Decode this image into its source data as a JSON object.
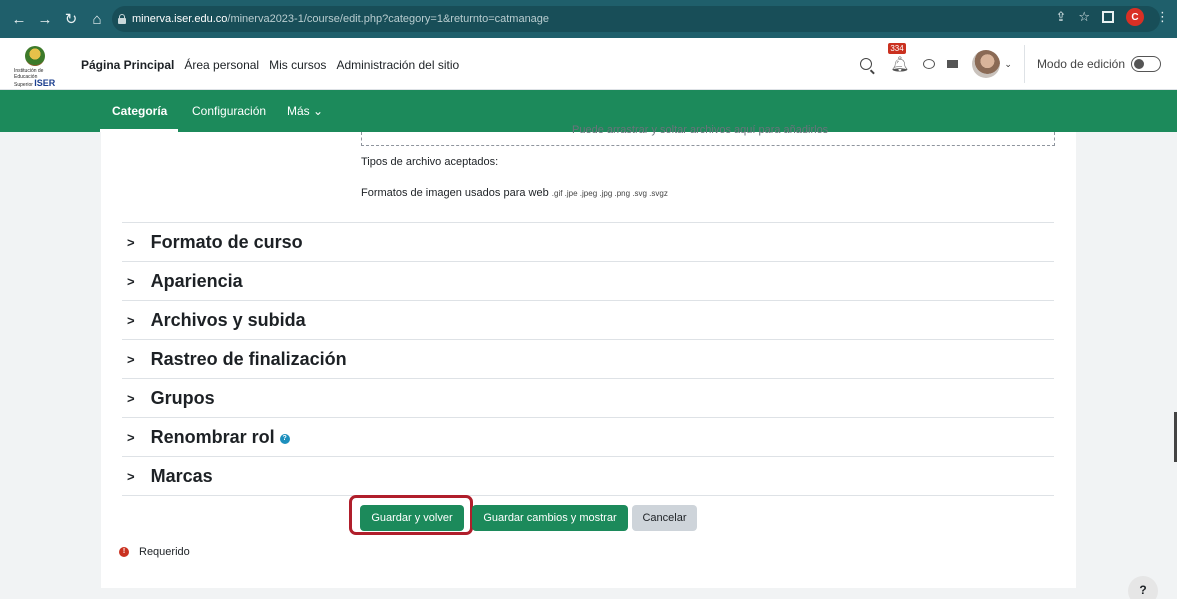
{
  "browser": {
    "url_domain": "minerva.iser.edu.co",
    "url_path": "/minerva2023-1/course/edit.php?category=1&returnto=catmanage",
    "profile_initial": "C"
  },
  "header": {
    "logo_small_text": "Institución de Educación Superior",
    "logo_brand": "ISER",
    "nav": [
      "Página Principal",
      "Área personal",
      "Mis cursos",
      "Administración del sitio"
    ],
    "notification_count": "334",
    "edit_mode_label": "Modo de edición"
  },
  "secondary_nav": {
    "tabs": [
      "Categoría",
      "Configuración",
      "Más ⌄"
    ]
  },
  "main": {
    "filepicker_hint": "Puede arrastrar y soltar archivos aquí para añadirlos",
    "accepted_label": "Tipos de archivo aceptados:",
    "accepted_formats_label": "Formatos de imagen usados para web",
    "accepted_formats_ext": ".gif .jpe .jpeg .jpg .png .svg .svgz",
    "sections": [
      "Formato de curso",
      "Apariencia",
      "Archivos y subida",
      "Rastreo de finalización",
      "Grupos",
      "Renombrar rol",
      "Marcas"
    ],
    "buttons": {
      "save_return": "Guardar y volver",
      "save_show": "Guardar cambios y mostrar",
      "cancel": "Cancelar"
    },
    "required_label": "Requerido"
  },
  "help_button": "?",
  "colors": {
    "brand_green": "#1c8a5b",
    "browser_teal": "#1f5f6b",
    "highlight_red": "#b01e2b"
  }
}
